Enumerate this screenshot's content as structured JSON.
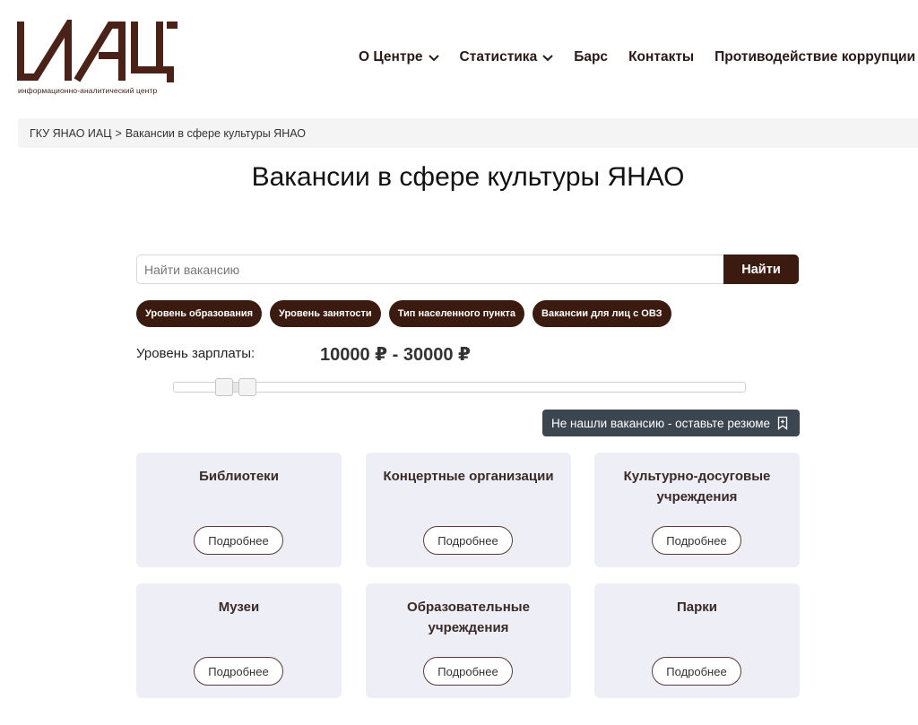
{
  "logo": {
    "name": "ИАЦ",
    "subtitle": "информационно-аналитический центр",
    "color": "#4a2218"
  },
  "nav": {
    "items": [
      {
        "label": "О Центре",
        "has_dropdown": true
      },
      {
        "label": "Статистика",
        "has_dropdown": true
      },
      {
        "label": "Барс",
        "has_dropdown": false
      },
      {
        "label": "Контакты",
        "has_dropdown": false
      },
      {
        "label": "Противодействие коррупции",
        "has_dropdown": false
      }
    ]
  },
  "breadcrumb": {
    "home": "ГКУ ЯНАО ИАЦ",
    "separator": ">",
    "current": "Вакансии в сфере культуры ЯНАО"
  },
  "page": {
    "title": "Вакансии в сфере культуры ЯНАО"
  },
  "search": {
    "placeholder": "Найти вакансию",
    "value": "",
    "button_label": "Найти"
  },
  "filters": [
    {
      "label": "Уровень образования"
    },
    {
      "label": "Уровень занятости"
    },
    {
      "label": "Тип населенного пункта"
    },
    {
      "label": "Вакансии для лиц с ОВЗ"
    }
  ],
  "salary": {
    "label": "Уровень зарплаты:",
    "display": "10000 ₽ - 30000 ₽",
    "min": 0,
    "max": 300000,
    "low": 10000,
    "high": 30000
  },
  "resume": {
    "label": "Не нашли вакансию - оставьте резюме",
    "icon": "bookmark-plus-icon"
  },
  "categories": [
    {
      "title": "Библиотеки",
      "button": "Подробнее"
    },
    {
      "title": "Концертные организации",
      "button": "Подробнее"
    },
    {
      "title": "Культурно-досуговые учреждения",
      "button": "Подробнее"
    },
    {
      "title": "Музеи",
      "button": "Подробнее"
    },
    {
      "title": "Образовательные учреждения",
      "button": "Подробнее"
    },
    {
      "title": "Парки",
      "button": "Подробнее"
    }
  ],
  "colors": {
    "brand": "#3b1a10",
    "resume_button": "#3c4650",
    "card_background": "#eeeef7"
  }
}
